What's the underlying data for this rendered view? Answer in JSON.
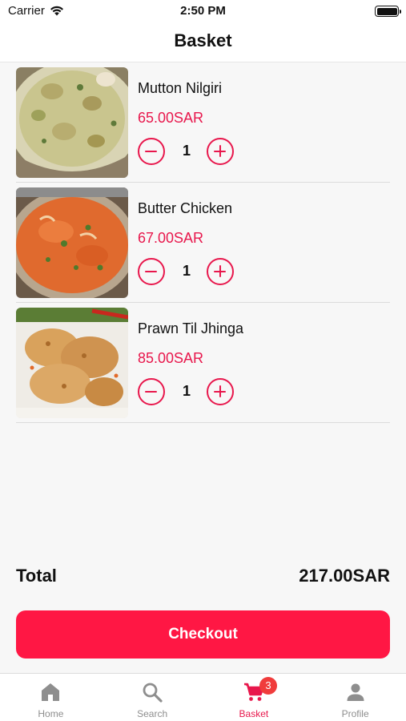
{
  "status_bar": {
    "carrier": "Carrier",
    "time": "2:50 PM"
  },
  "nav": {
    "title": "Basket"
  },
  "items": [
    {
      "name": "Mutton Nilgiri",
      "price": "65.00SAR",
      "quantity": "1"
    },
    {
      "name": "Butter Chicken",
      "price": "67.00SAR",
      "quantity": "1"
    },
    {
      "name": "Prawn Til Jhinga",
      "price": "85.00SAR",
      "quantity": "1"
    }
  ],
  "total": {
    "label": "Total",
    "amount": "217.00SAR"
  },
  "checkout": {
    "label": "Checkout"
  },
  "tabs": [
    {
      "label": "Home",
      "icon": "home-icon"
    },
    {
      "label": "Search",
      "icon": "search-icon"
    },
    {
      "label": "Basket",
      "icon": "cart-icon",
      "badge": "3",
      "active": true
    },
    {
      "label": "Profile",
      "icon": "person-icon"
    }
  ],
  "colors": {
    "accent": "#e8174c",
    "button": "#ff1744",
    "badge": "#f03c3c",
    "inactive_tab": "#8e8e8e"
  }
}
